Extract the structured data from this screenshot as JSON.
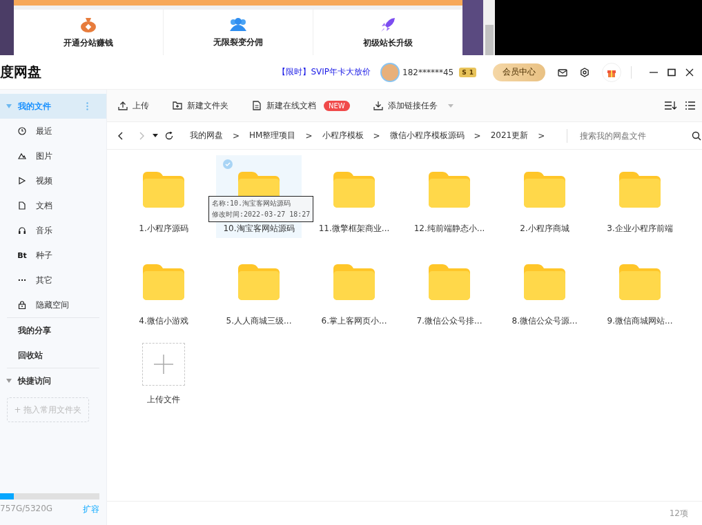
{
  "background_page": {
    "promo_items": [
      {
        "kind": "moneybag",
        "label": "开通分站赚钱"
      },
      {
        "kind": "people",
        "label": "无限裂变分佣"
      },
      {
        "kind": "rocket",
        "label": "初级站长升级"
      }
    ]
  },
  "window": {
    "title": "度网盘",
    "promo_link": "【限时】SVIP年卡大放价",
    "username": "182******45",
    "level_badge": "1",
    "badge_letter": "S",
    "vip_button": "会员中心"
  },
  "sidebar": {
    "items": [
      {
        "kind": "group",
        "label": "我的文件",
        "selected": true,
        "expanded": true
      },
      {
        "kind": "clock",
        "label": "最近",
        "selected": false
      },
      {
        "kind": "image",
        "label": "图片",
        "selected": false
      },
      {
        "kind": "video",
        "label": "视频",
        "selected": false
      },
      {
        "kind": "doc",
        "label": "文档",
        "selected": false
      },
      {
        "kind": "music",
        "label": "音乐",
        "selected": false
      },
      {
        "kind": "bt",
        "label": "种子",
        "icon_text": "Bt",
        "selected": false
      },
      {
        "kind": "more",
        "label": "其它",
        "icon_text": "···",
        "selected": false
      },
      {
        "kind": "lock",
        "label": "隐藏空间",
        "selected": false
      },
      {
        "kind": "top",
        "label": "我的分享",
        "selected": false
      },
      {
        "kind": "top",
        "label": "回收站",
        "selected": false
      },
      {
        "kind": "group",
        "label": "快捷访问",
        "selected": false,
        "expanded": true
      }
    ],
    "drop_hint": "+ 拖入常用文件夹",
    "storage": {
      "level": 0.14,
      "text": "757G/5320G",
      "expand": "扩容"
    }
  },
  "toolbar": {
    "buttons": [
      {
        "kind": "upload",
        "label": "上传"
      },
      {
        "kind": "folder",
        "label": "新建文件夹"
      },
      {
        "kind": "doc",
        "label": "新建在线文档",
        "badge": "NEW"
      },
      {
        "kind": "download",
        "label": "添加链接任务",
        "dropdown": true
      }
    ]
  },
  "breadcrumb": {
    "items": [
      "我的网盘",
      "HM整理项目",
      "小程序模板",
      "微信小程序模板源码",
      "2021更新"
    ],
    "separator": ">",
    "search_placeholder": "搜索我的网盘文件"
  },
  "files": [
    {
      "kind": "folder",
      "name": "1.小程序源码",
      "selected": false
    },
    {
      "kind": "folder",
      "name": "10.淘宝客网站源码",
      "selected": true
    },
    {
      "kind": "folder",
      "name": "11.微擎框架商业...",
      "selected": false
    },
    {
      "kind": "folder",
      "name": "12.纯前端静态小...",
      "selected": false
    },
    {
      "kind": "folder",
      "name": "2.小程序商城",
      "selected": false
    },
    {
      "kind": "folder",
      "name": "3.企业小程序前端",
      "selected": false
    },
    {
      "kind": "folder",
      "name": "4.微信小游戏",
      "selected": false
    },
    {
      "kind": "folder",
      "name": "5.人人商城三级...",
      "selected": false
    },
    {
      "kind": "folder",
      "name": "6.掌上客网页小...",
      "selected": false
    },
    {
      "kind": "folder",
      "name": "7.微信公众号排...",
      "selected": false
    },
    {
      "kind": "folder",
      "name": "8.微信公众号源...",
      "selected": false
    },
    {
      "kind": "folder",
      "name": "9.微信商城网站...",
      "selected": false
    },
    {
      "kind": "upload",
      "name": "上传文件",
      "selected": false
    }
  ],
  "tooltip": {
    "lines": [
      "名称:10.淘宝客网站源码",
      "修改时间:2022-03-27 18:27"
    ]
  },
  "status_bar": {
    "count": "12项"
  }
}
